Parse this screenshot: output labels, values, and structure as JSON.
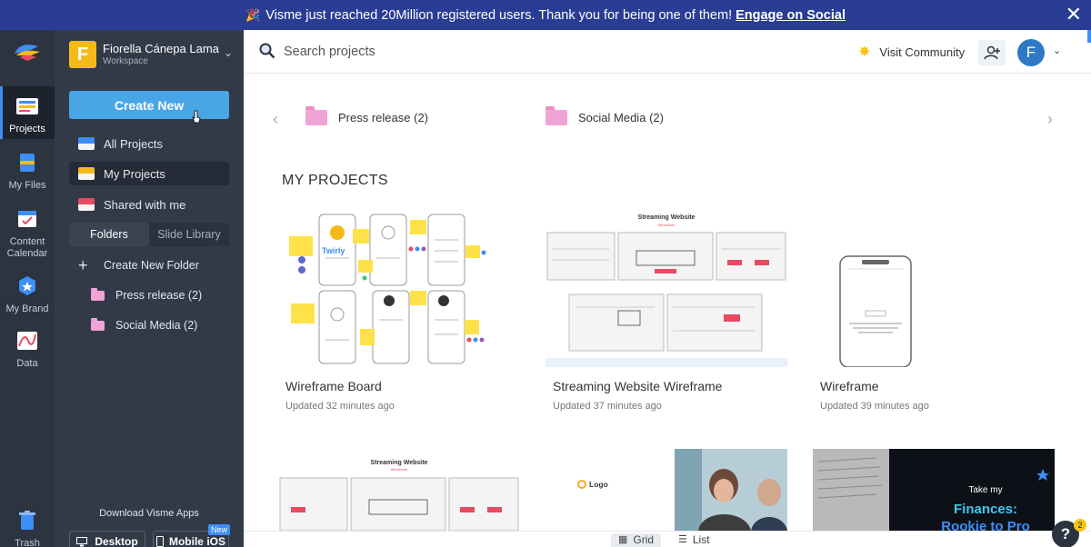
{
  "banner": {
    "message": "Visme just reached 20Million registered users. Thank you for being one of them!",
    "link": "Engage on Social",
    "close": "✕"
  },
  "rail": {
    "items": [
      {
        "label": "Projects",
        "icon": "projects-icon"
      },
      {
        "label": "My Files",
        "icon": "files-icon"
      },
      {
        "label": "Content Calendar",
        "icon": "calendar-icon"
      },
      {
        "label": "My Brand",
        "icon": "brand-icon"
      },
      {
        "label": "Data",
        "icon": "data-icon"
      },
      {
        "label": "Trash",
        "icon": "trash-icon"
      }
    ]
  },
  "workspace": {
    "initial": "F",
    "name": "Fiorella Cánepa Lama",
    "type": "Workspace"
  },
  "sidebar": {
    "create_label": "Create New",
    "nav": [
      {
        "label": "All Projects"
      },
      {
        "label": "My Projects"
      },
      {
        "label": "Shared with me"
      }
    ],
    "tabs": [
      {
        "label": "Folders"
      },
      {
        "label": "Slide Library"
      }
    ],
    "create_folder": "Create New Folder",
    "folders": [
      {
        "label": "Press release (2)"
      },
      {
        "label": "Social Media (2)"
      }
    ],
    "download_label": "Download Visme Apps",
    "desktop_label": "Desktop",
    "mobile_label": "Mobile iOS",
    "new_badge": "New"
  },
  "search": {
    "placeholder": "Search projects"
  },
  "header": {
    "community": "Visit Community",
    "avatar_initial": "F"
  },
  "folder_strip": [
    {
      "label": "Press release",
      "count": "(2)"
    },
    {
      "label": "Social Media",
      "count": "(2)"
    }
  ],
  "section_title": "MY PROJECTS",
  "projects": [
    {
      "title": "Wireframe Board",
      "updated": "Updated 32 minutes ago",
      "thumb_text": [
        "Twirly"
      ]
    },
    {
      "title": "Streaming Website Wireframe",
      "updated": "Updated 37 minutes ago",
      "thumb_text": [
        "Streaming Website",
        "Wireframe"
      ]
    },
    {
      "title": "Wireframe",
      "updated": "Updated 39 minutes ago",
      "thumb_text": []
    }
  ],
  "projects_row2": [
    {
      "thumb_text": [
        "Streaming Website",
        "Wireframe"
      ]
    },
    {
      "thumb_text": [
        "Logo"
      ]
    },
    {
      "thumb_text": [
        "Take my",
        "Finances:",
        "Rookie to Pro"
      ]
    }
  ],
  "view": {
    "grid": "Grid",
    "list": "List"
  },
  "help": {
    "label": "?",
    "badge": "2"
  }
}
